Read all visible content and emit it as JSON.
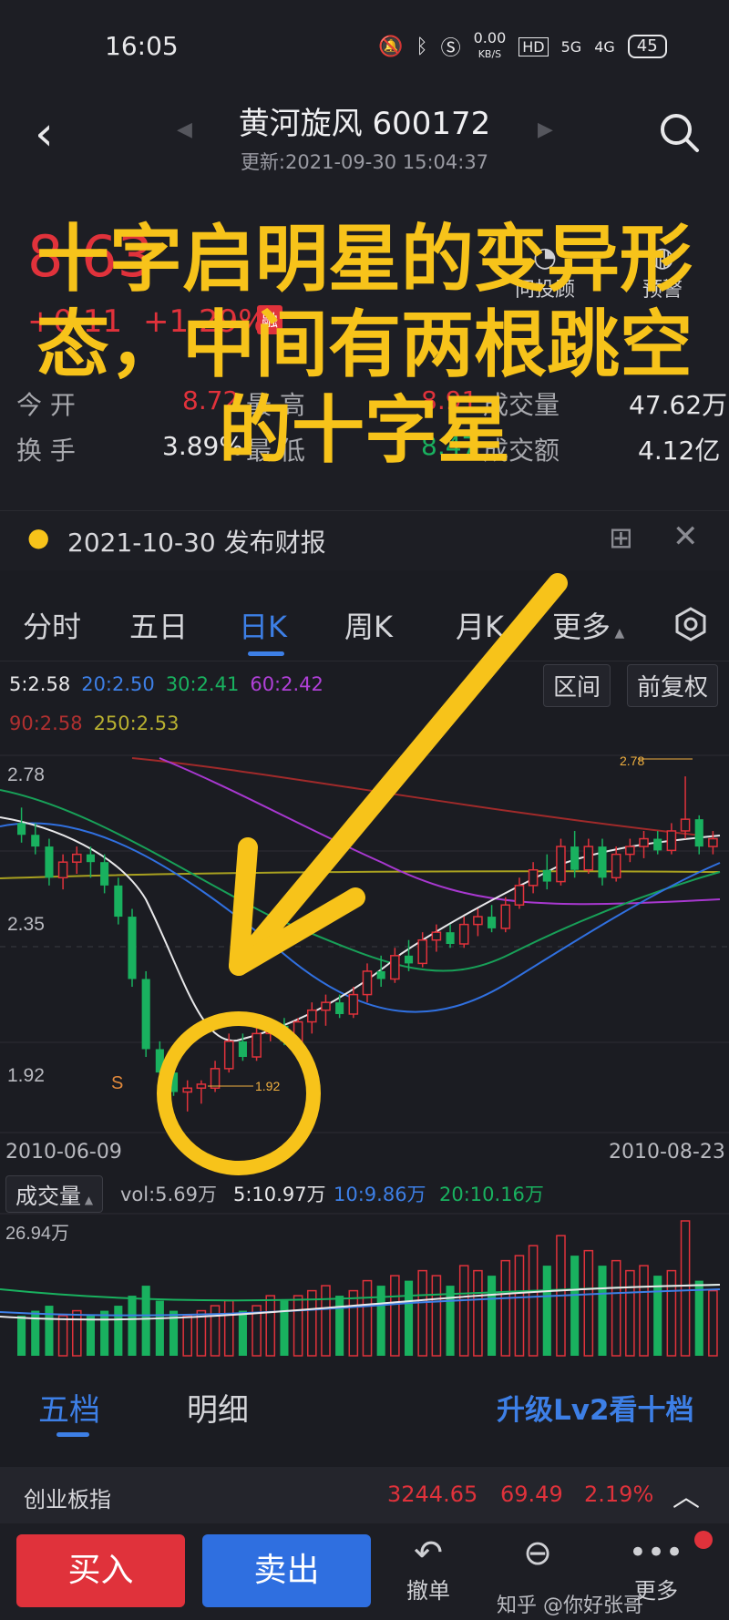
{
  "status_bar": {
    "time": "16:05",
    "net_speed": "0.00",
    "net_unit": "KB/S",
    "hd": "HD",
    "sig1": "5G",
    "sig2": "4G",
    "battery": "45"
  },
  "header": {
    "title": "黄河旋风 600172",
    "updated": "更新:2021-09-30 15:04:37"
  },
  "quote": {
    "price": "8.63",
    "change": "+0.11",
    "change_pct": "+1.29%",
    "rong": "融",
    "tools": [
      "问投顾",
      "预警"
    ],
    "rows": [
      {
        "label": "今 开",
        "value": "8.72",
        "label2": "最 高",
        "value2": "8.91",
        "label3": "成交量",
        "value3": "47.62万"
      },
      {
        "label": "换 手",
        "value": "3.89%",
        "label2": "最 低",
        "value2": "8.47",
        "label3": "成交额",
        "value3": "4.12亿"
      }
    ],
    "notice": "2021-10-30 发布财报"
  },
  "tabs": [
    "分时",
    "五日",
    "日K",
    "周K",
    "月K",
    "更多"
  ],
  "ma": {
    "line1": [
      {
        "text": "5:2.58",
        "color": "#e8e8ea"
      },
      {
        "text": "20:2.50",
        "color": "#3d7fe6"
      },
      {
        "text": "30:2.41",
        "color": "#19b15f"
      },
      {
        "text": "60:2.42",
        "color": "#b040d8"
      }
    ],
    "line2": [
      {
        "text": "90:2.58",
        "color": "#b03030"
      },
      {
        "text": "250:2.53",
        "color": "#b8b030"
      }
    ],
    "btn_range": "区间",
    "btn_adjust": "前复权"
  },
  "chart_data": {
    "type": "candlestick",
    "y_labels": {
      "top": "2.78",
      "mid": "2.35",
      "bottom": "1.92"
    },
    "ylim": [
      1.88,
      2.82
    ],
    "max_marker": "2.78",
    "min_marker": "1.92",
    "s_marker": "S",
    "start_date": "2010-06-09",
    "end_date": "2010-08-23",
    "candles": [
      [
        2.66,
        2.7,
        2.61,
        2.63
      ],
      [
        2.63,
        2.66,
        2.58,
        2.6
      ],
      [
        2.6,
        2.62,
        2.5,
        2.52
      ],
      [
        2.52,
        2.58,
        2.49,
        2.56
      ],
      [
        2.56,
        2.6,
        2.53,
        2.58
      ],
      [
        2.58,
        2.6,
        2.52,
        2.56
      ],
      [
        2.56,
        2.58,
        2.48,
        2.5
      ],
      [
        2.5,
        2.52,
        2.4,
        2.42
      ],
      [
        2.42,
        2.44,
        2.24,
        2.26
      ],
      [
        2.26,
        2.28,
        2.06,
        2.08
      ],
      [
        2.08,
        2.1,
        2.01,
        2.02
      ],
      [
        2.02,
        2.04,
        1.96,
        1.97
      ],
      [
        1.97,
        2.0,
        1.92,
        1.98
      ],
      [
        1.98,
        2.0,
        1.94,
        1.99
      ],
      [
        1.98,
        2.05,
        1.97,
        2.03
      ],
      [
        2.03,
        2.12,
        2.02,
        2.1
      ],
      [
        2.1,
        2.12,
        2.05,
        2.06
      ],
      [
        2.06,
        2.14,
        2.05,
        2.12
      ],
      [
        2.12,
        2.16,
        2.1,
        2.14
      ],
      [
        2.14,
        2.16,
        2.09,
        2.1
      ],
      [
        2.1,
        2.16,
        2.09,
        2.15
      ],
      [
        2.15,
        2.2,
        2.12,
        2.18
      ],
      [
        2.18,
        2.22,
        2.14,
        2.2
      ],
      [
        2.2,
        2.22,
        2.16,
        2.17
      ],
      [
        2.17,
        2.24,
        2.16,
        2.22
      ],
      [
        2.22,
        2.3,
        2.2,
        2.28
      ],
      [
        2.28,
        2.32,
        2.24,
        2.26
      ],
      [
        2.26,
        2.34,
        2.25,
        2.32
      ],
      [
        2.32,
        2.36,
        2.28,
        2.3
      ],
      [
        2.3,
        2.38,
        2.29,
        2.36
      ],
      [
        2.36,
        2.4,
        2.33,
        2.38
      ],
      [
        2.38,
        2.4,
        2.34,
        2.35
      ],
      [
        2.35,
        2.42,
        2.34,
        2.4
      ],
      [
        2.4,
        2.44,
        2.37,
        2.42
      ],
      [
        2.42,
        2.45,
        2.38,
        2.39
      ],
      [
        2.39,
        2.47,
        2.38,
        2.45
      ],
      [
        2.45,
        2.52,
        2.44,
        2.5
      ],
      [
        2.5,
        2.56,
        2.48,
        2.54
      ],
      [
        2.54,
        2.58,
        2.49,
        2.51
      ],
      [
        2.51,
        2.62,
        2.5,
        2.6
      ],
      [
        2.6,
        2.64,
        2.52,
        2.54
      ],
      [
        2.54,
        2.62,
        2.53,
        2.6
      ],
      [
        2.6,
        2.62,
        2.5,
        2.52
      ],
      [
        2.52,
        2.6,
        2.51,
        2.58
      ],
      [
        2.58,
        2.62,
        2.56,
        2.6
      ],
      [
        2.6,
        2.64,
        2.57,
        2.62
      ],
      [
        2.62,
        2.64,
        2.58,
        2.59
      ],
      [
        2.59,
        2.66,
        2.58,
        2.64
      ],
      [
        2.64,
        2.78,
        2.62,
        2.67
      ],
      [
        2.67,
        2.68,
        2.58,
        2.6
      ],
      [
        2.6,
        2.64,
        2.58,
        2.62
      ]
    ]
  },
  "volume": {
    "label": "成交量",
    "vol": "vol:5.69万",
    "ma5": "5:10.97万",
    "ma10": "10:9.86万",
    "ma20": "20:10.16万",
    "axis_max": "26.94万",
    "bars": [
      8,
      9,
      10,
      8,
      9,
      8,
      9,
      10,
      12,
      14,
      11,
      9,
      8,
      9,
      10,
      11,
      9,
      10,
      12,
      11,
      12,
      13,
      14,
      12,
      13,
      15,
      14,
      16,
      15,
      17,
      16,
      14,
      18,
      17,
      16,
      19,
      20,
      22,
      18,
      24,
      20,
      21,
      18,
      19,
      17,
      18,
      16,
      17,
      26.94,
      15,
      13
    ]
  },
  "orderbook": {
    "tab1": "五档",
    "tab2": "明细",
    "upgrade": "升级Lv2看十档"
  },
  "index_bar": {
    "name": "创业板指",
    "value": "3244.65",
    "change": "69.49",
    "pct": "2.19%"
  },
  "bottom_bar": {
    "buy": "买入",
    "sell": "卖出",
    "cancel": "撤单",
    "more": "更多"
  },
  "annotation": {
    "text": "十字启明星的变异形态，中间有两根跳空的十字星",
    "watermark": "知乎 @你好张哥"
  },
  "colors": {
    "up": "#e0323b",
    "down": "#19b15f",
    "accent": "#3d7fe6",
    "annotation": "#f7c31a"
  }
}
